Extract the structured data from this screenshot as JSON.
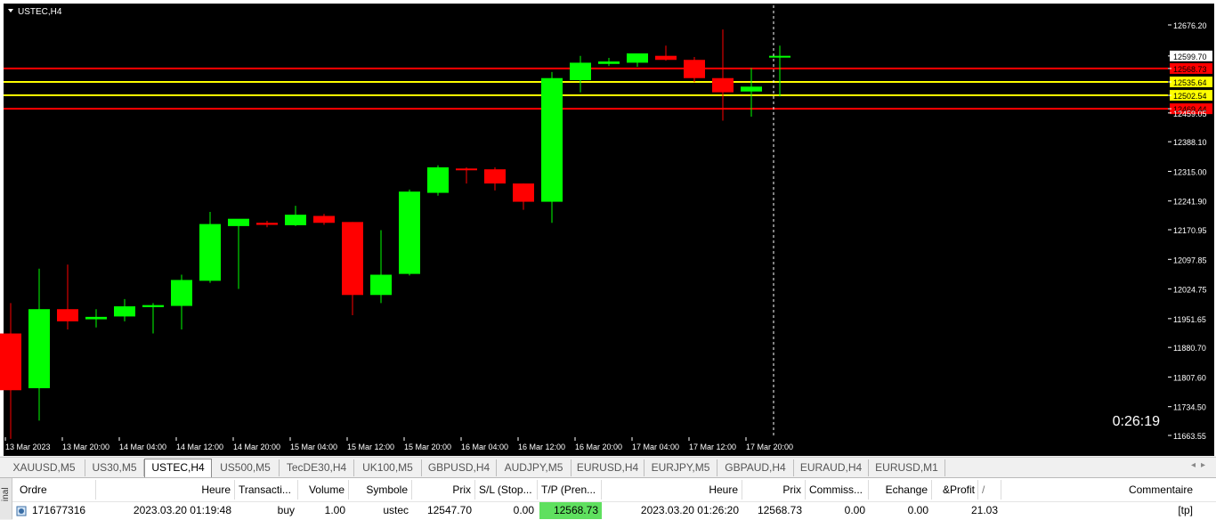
{
  "chart": {
    "symbol_label": "USTEC,H4",
    "countdown": "0:26:19",
    "colors": {
      "bull": "#00ff00",
      "bear": "#ff0000",
      "background": "#000000",
      "text": "#ffffff"
    },
    "price_labels": [
      "12676.20",
      "12599.70",
      "12568.73",
      "12535.64",
      "12502.54",
      "12469.44",
      "12459.05",
      "12388.10",
      "12315.00",
      "12241.90",
      "12170.95",
      "12097.85",
      "12024.75",
      "11951.65",
      "11880.70",
      "11807.60",
      "11734.50",
      "11663.55"
    ],
    "time_labels": [
      "13 Mar 2023",
      "13 Mar 20:00",
      "14 Mar 04:00",
      "14 Mar 12:00",
      "14 Mar 20:00",
      "15 Mar 04:00",
      "15 Mar 12:00",
      "15 Mar 20:00",
      "16 Mar 04:00",
      "16 Mar 12:00",
      "16 Mar 20:00",
      "17 Mar 04:00",
      "17 Mar 12:00",
      "17 Mar 20:00"
    ]
  },
  "chart_data": {
    "type": "candlestick",
    "symbol": "USTEC",
    "timeframe": "H4",
    "ylim": [
      11663.55,
      12676.2
    ],
    "grid": false,
    "horizontal_levels": [
      {
        "price": 12568.73,
        "color": "#ff0000"
      },
      {
        "price": 12535.64,
        "color": "#ffff00"
      },
      {
        "price": 12502.54,
        "color": "#ffff00"
      },
      {
        "price": 12469.44,
        "color": "#ff0000"
      }
    ],
    "current_price": 12599.7,
    "candles": [
      {
        "o": 11915,
        "h": 11990,
        "l": 11655,
        "c": 11775
      },
      {
        "o": 11780,
        "h": 12075,
        "l": 11700,
        "c": 11975
      },
      {
        "o": 11975,
        "h": 12085,
        "l": 11925,
        "c": 11945
      },
      {
        "o": 11950,
        "h": 11975,
        "l": 11930,
        "c": 11956
      },
      {
        "o": 11957,
        "h": 12000,
        "l": 11945,
        "c": 11982
      },
      {
        "o": 11980,
        "h": 11990,
        "l": 11915,
        "c": 11985
      },
      {
        "o": 11983,
        "h": 12060,
        "l": 11925,
        "c": 12047
      },
      {
        "o": 12045,
        "h": 12215,
        "l": 12040,
        "c": 12185
      },
      {
        "o": 12180,
        "h": 12195,
        "l": 12025,
        "c": 12198
      },
      {
        "o": 12188,
        "h": 12193,
        "l": 12177,
        "c": 12183
      },
      {
        "o": 12182,
        "h": 12230,
        "l": 12180,
        "c": 12208
      },
      {
        "o": 12205,
        "h": 12210,
        "l": 12183,
        "c": 12188
      },
      {
        "o": 12190,
        "h": 12190,
        "l": 11960,
        "c": 12010
      },
      {
        "o": 12010,
        "h": 12170,
        "l": 11990,
        "c": 12060
      },
      {
        "o": 12062,
        "h": 12270,
        "l": 12058,
        "c": 12265
      },
      {
        "o": 12262,
        "h": 12330,
        "l": 12255,
        "c": 12325
      },
      {
        "o": 12322,
        "h": 12325,
        "l": 12285,
        "c": 12318
      },
      {
        "o": 12320,
        "h": 12325,
        "l": 12268,
        "c": 12285
      },
      {
        "o": 12285,
        "h": 12285,
        "l": 12220,
        "c": 12240
      },
      {
        "o": 12240,
        "h": 12560,
        "l": 12188,
        "c": 12545
      },
      {
        "o": 12540,
        "h": 12600,
        "l": 12510,
        "c": 12583
      },
      {
        "o": 12580,
        "h": 12595,
        "l": 12575,
        "c": 12586
      },
      {
        "o": 12583,
        "h": 12604,
        "l": 12573,
        "c": 12606
      },
      {
        "o": 12600,
        "h": 12625,
        "l": 12588,
        "c": 12590
      },
      {
        "o": 12590,
        "h": 12597,
        "l": 12535,
        "c": 12545
      },
      {
        "o": 12545,
        "h": 12665,
        "l": 12440,
        "c": 12510
      },
      {
        "o": 12512,
        "h": 12570,
        "l": 12450,
        "c": 12524
      },
      {
        "o": 12599,
        "h": 12625,
        "l": 12500,
        "c": 12600
      }
    ],
    "xtick_labels": [
      "13 Mar 2023",
      "13 Mar 20:00",
      "14 Mar 04:00",
      "14 Mar 12:00",
      "14 Mar 20:00",
      "15 Mar 04:00",
      "15 Mar 12:00",
      "15 Mar 20:00",
      "16 Mar 04:00",
      "16 Mar 12:00",
      "16 Mar 20:00",
      "17 Mar 04:00",
      "17 Mar 12:00",
      "17 Mar 20:00"
    ]
  },
  "tabs": [
    "XAUUSD,M5",
    "US30,M5",
    "USTEC,H4",
    "US500,M5",
    "TecDE30,H4",
    "UK100,M5",
    "GBPUSD,H4",
    "AUDJPY,M5",
    "EURUSD,H4",
    "EURJPY,M5",
    "GBPAUD,H4",
    "EURAUD,H4",
    "EURUSD,M1"
  ],
  "tabs_active": "USTEC,H4",
  "terminal": {
    "side_label": "inal",
    "headers": [
      "Ordre",
      "Heure",
      "Transacti...",
      "Volume",
      "Symbole",
      "Prix",
      "S/L (Stop...",
      "T/P (Pren...",
      "Heure",
      "Prix",
      "Commiss...",
      "Echange",
      "&Profit",
      "/",
      "Commentaire"
    ],
    "row": {
      "ordre": "171677316",
      "heure": "2023.03.20 01:19:48",
      "transaction": "buy",
      "volume": "1.00",
      "symbole": "ustec",
      "prix": "12547.70",
      "sl": "0.00",
      "tp": "12568.73",
      "heure_close": "2023.03.20 01:26:20",
      "prix_close": "12568.73",
      "commission": "0.00",
      "echange": "0.00",
      "profit": "21.03",
      "commentaire": "[tp]"
    }
  }
}
